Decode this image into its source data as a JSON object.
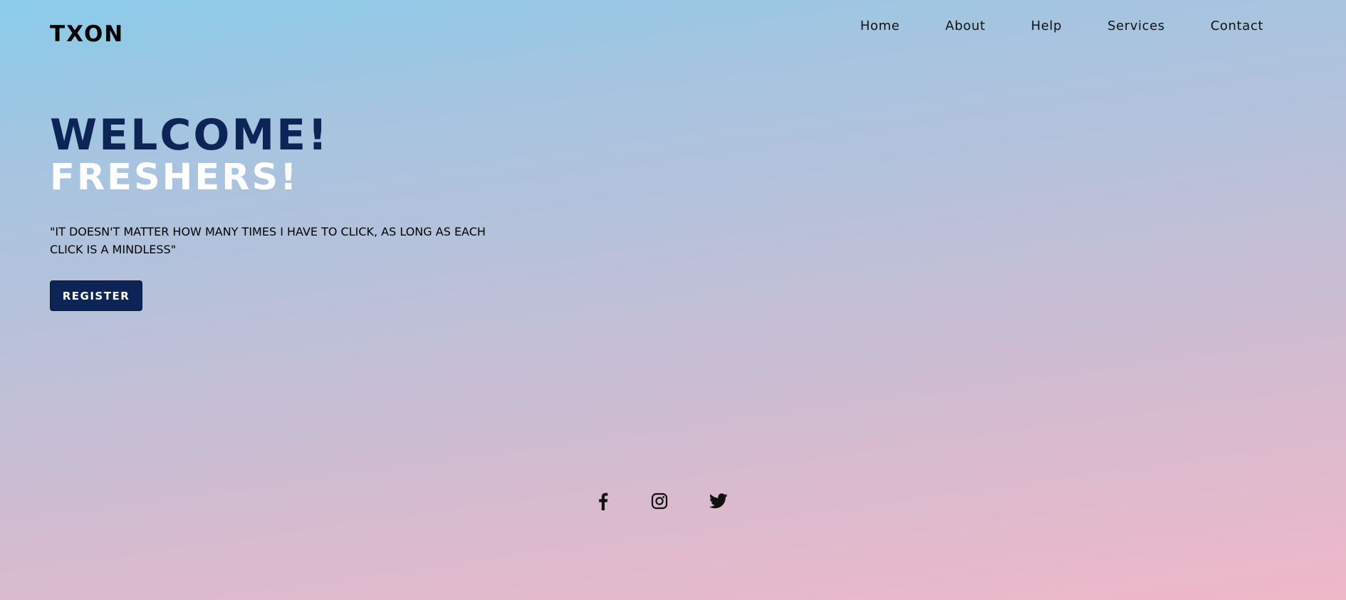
{
  "header": {
    "logo": "TXON",
    "nav": [
      {
        "label": "Home"
      },
      {
        "label": "About"
      },
      {
        "label": "Help"
      },
      {
        "label": "Services"
      },
      {
        "label": "Contact"
      }
    ]
  },
  "hero": {
    "title": "WELCOME!",
    "subtitle": "FRESHERS!",
    "quote": "\"IT DOESN'T MATTER HOW MANY TIMES I HAVE TO CLICK, AS LONG AS EACH CLICK IS A MINDLESS\"",
    "register_label": "REGISTER"
  },
  "social": {
    "icons": [
      "facebook-icon",
      "instagram-icon",
      "twitter-icon"
    ]
  },
  "colors": {
    "accent": "#0c2456",
    "gradient_top": "#8acce9",
    "gradient_bottom": "#efb8c8"
  }
}
